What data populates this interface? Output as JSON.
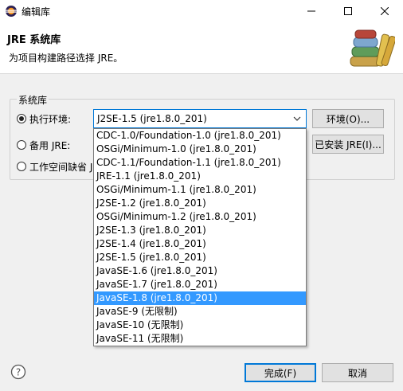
{
  "window": {
    "title": "编辑库"
  },
  "header": {
    "title": "JRE 系统库",
    "subtitle": "为项目构建路径选择 JRE。"
  },
  "group": {
    "label": "系统库",
    "execution_env_label": "执行环境:",
    "alternate_jre_label": "备用 JRE:",
    "workspace_default_label": "工作空间缺省 J"
  },
  "combo": {
    "selected_value": "J2SE-1.5  (jre1.8.0_201)"
  },
  "buttons": {
    "environments": "环境(O)...",
    "installed_jres": "已安装 JRE(I)...",
    "finish": "完成(F)",
    "cancel": "取消"
  },
  "dropdown": {
    "items": [
      "CDC-1.0/Foundation-1.0  (jre1.8.0_201)",
      "OSGi/Minimum-1.0  (jre1.8.0_201)",
      "CDC-1.1/Foundation-1.1  (jre1.8.0_201)",
      "JRE-1.1  (jre1.8.0_201)",
      "OSGi/Minimum-1.1  (jre1.8.0_201)",
      "J2SE-1.2  (jre1.8.0_201)",
      "OSGi/Minimum-1.2  (jre1.8.0_201)",
      "J2SE-1.3  (jre1.8.0_201)",
      "J2SE-1.4  (jre1.8.0_201)",
      "J2SE-1.5  (jre1.8.0_201)",
      "JavaSE-1.6  (jre1.8.0_201)",
      "JavaSE-1.7  (jre1.8.0_201)",
      "JavaSE-1.8  (jre1.8.0_201)",
      "JavaSE-9  (无限制)",
      "JavaSE-10  (无限制)",
      "JavaSE-11  (无限制)"
    ],
    "highlighted_index": 12
  },
  "colors": {
    "accent": "#0078d7",
    "highlight": "#3399ff"
  },
  "icons": [
    "eclipse-app-icon",
    "minimize-icon",
    "maximize-icon",
    "close-icon",
    "library-books-icon",
    "chevron-down-icon",
    "help-icon"
  ]
}
